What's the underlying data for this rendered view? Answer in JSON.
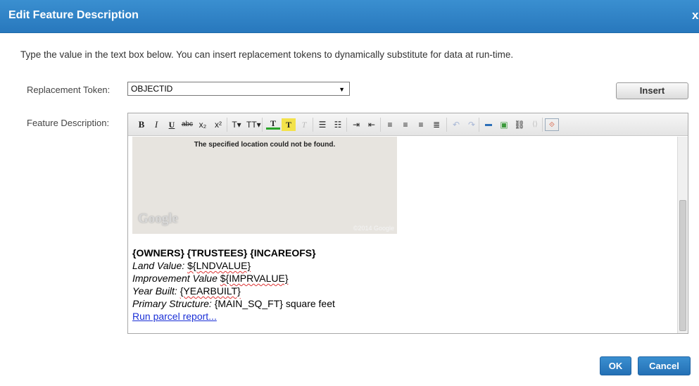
{
  "dialog": {
    "title": "Edit Feature Description",
    "close_glyph": "x",
    "instructions": "Type the value in the text box below. You can insert replacement tokens to dynamically substitute for data at run-time."
  },
  "token": {
    "label": "Replacement Token:",
    "selected": "OBJECTID",
    "insert_label": "Insert"
  },
  "description": {
    "label": "Feature Description:",
    "toolbar": [
      {
        "name": "bold-icon",
        "glyph": "B"
      },
      {
        "name": "italic-icon",
        "glyph": "I"
      },
      {
        "name": "underline-icon",
        "glyph": "U"
      },
      {
        "name": "strikethrough-icon",
        "glyph": "abc"
      },
      {
        "name": "subscript-icon",
        "glyph": "x₂"
      },
      {
        "name": "superscript-icon",
        "glyph": "x²"
      },
      {
        "name": "font-size-icon",
        "glyph": "T▾"
      },
      {
        "name": "font-family-icon",
        "glyph": "TT▾"
      },
      {
        "name": "text-color-icon",
        "glyph": "T"
      },
      {
        "name": "highlight-icon",
        "glyph": "T"
      },
      {
        "name": "clear-format-icon",
        "glyph": "T"
      },
      {
        "name": "bullet-list-icon",
        "glyph": "☰"
      },
      {
        "name": "numbered-list-icon",
        "glyph": "☷"
      },
      {
        "name": "indent-icon",
        "glyph": "⇥"
      },
      {
        "name": "outdent-icon",
        "glyph": "⇤"
      },
      {
        "name": "align-left-icon",
        "glyph": "≡"
      },
      {
        "name": "align-center-icon",
        "glyph": "≡"
      },
      {
        "name": "align-right-icon",
        "glyph": "≡"
      },
      {
        "name": "justify-icon",
        "glyph": "≣"
      },
      {
        "name": "undo-icon",
        "glyph": "↶"
      },
      {
        "name": "redo-icon",
        "glyph": "↷"
      },
      {
        "name": "horizontal-rule-icon",
        "glyph": "▬"
      },
      {
        "name": "insert-image-icon",
        "glyph": "▣"
      },
      {
        "name": "insert-link-icon",
        "glyph": "⛓"
      },
      {
        "name": "unlink-icon",
        "glyph": "⟨⟩"
      },
      {
        "name": "html-source-icon",
        "glyph": "⟐"
      }
    ],
    "map": {
      "message": "The specified location could not be found.",
      "logo": "Google",
      "copyright": "©2014 Google"
    },
    "heading": "{OWNERS} {TRUSTEES} {INCAREOFS}",
    "land_label": "Land Value:",
    "land_value": "${LNDVALUE}",
    "improvement_label": "Improvement Value",
    "improvement_value": "${IMPRVALUE}",
    "year_label": "Year Built:",
    "year_value": "{YEARBUILT}",
    "structure_label": "Primary Structure:",
    "structure_value": "{MAIN_SQ_FT} square feet",
    "link_text": "Run parcel report..."
  },
  "footer": {
    "ok_label": "OK",
    "cancel_label": "Cancel"
  },
  "colors": {
    "title_bar": "#2f83c7",
    "primary_button": "#2a7bc0",
    "link": "#1a2fd6"
  }
}
